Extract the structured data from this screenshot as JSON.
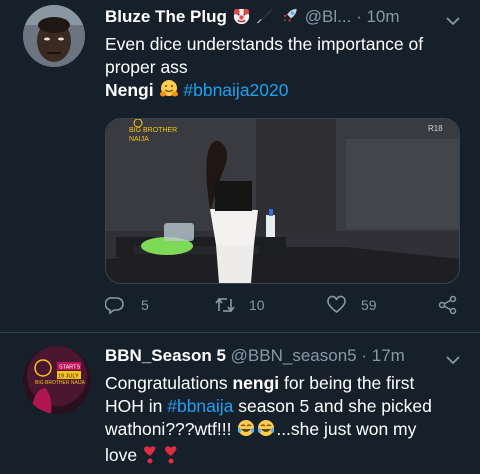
{
  "tweets": [
    {
      "display_name": "Bluze The Plug",
      "handle": "@Bl...",
      "separator": "·",
      "time": "10m",
      "line1": "Even dice understands the importance of",
      "line2": "proper ass",
      "mention_name": "Nengi",
      "hashtag": "#bbnaija2020",
      "media_brand_top": "BIG BROTHER",
      "media_brand_bottom": "NAIJA",
      "media_channel": "R18",
      "actions": {
        "replies": "5",
        "retweets": "10",
        "likes": "59"
      }
    },
    {
      "display_name": "BBN_Season 5",
      "handle": "@BBN_season5",
      "separator": "·",
      "time": "17m",
      "text_a": "Congratulations ",
      "bold_word": "nengi",
      "text_b": " for being the first",
      "text_c": "HOH in ",
      "hashtag": "#bbnaija",
      "text_d": " season 5 and she picked",
      "text_e": "wathoni???wtf!!! ",
      "text_f": "...she just won my",
      "text_g": "love ",
      "avatar_text_1": "BIG BROTHER NAIJA",
      "avatar_text_2": "STARTS",
      "avatar_text_3": "19 JULY"
    }
  ],
  "colors": {
    "background": "#15202b",
    "secondary_text": "#8899a6",
    "link": "#1da1f2",
    "divider": "#38444d"
  },
  "icons": [
    "clown-face-emoji",
    "black-feather-emoji",
    "rocket-emoji",
    "hugging-face-emoji",
    "tears-of-joy-emoji",
    "heart-exclamation-emoji",
    "chevron-down-icon",
    "reply-icon",
    "retweet-icon",
    "like-icon",
    "share-icon"
  ]
}
